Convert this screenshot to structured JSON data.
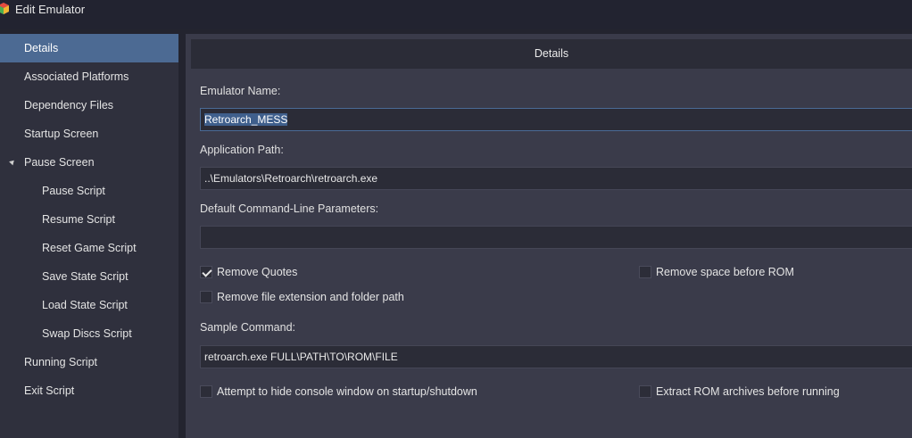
{
  "window": {
    "title": "Edit Emulator"
  },
  "sidebar": {
    "items": [
      {
        "label": "Details",
        "selected": true
      },
      {
        "label": "Associated Platforms"
      },
      {
        "label": "Dependency Files"
      },
      {
        "label": "Startup Screen"
      },
      {
        "label": "Pause Screen",
        "expanded": true
      },
      {
        "label": "Pause Script"
      },
      {
        "label": "Resume Script"
      },
      {
        "label": "Reset Game Script"
      },
      {
        "label": "Save State Script"
      },
      {
        "label": "Load State Script"
      },
      {
        "label": "Swap Discs Script"
      },
      {
        "label": "Running Script"
      },
      {
        "label": "Exit Script"
      }
    ]
  },
  "details": {
    "header": "Details",
    "emulator_name_label": "Emulator Name:",
    "emulator_name_value": "Retroarch_MESS",
    "application_path_label": "Application Path:",
    "application_path_value": "..\\Emulators\\Retroarch\\retroarch.exe",
    "default_params_label": "Default Command-Line Parameters:",
    "default_params_value": "",
    "remove_quotes_label": "Remove Quotes",
    "remove_quotes_checked": true,
    "remove_space_label": "Remove space before ROM",
    "remove_space_checked": false,
    "remove_ext_label": "Remove file extension and folder path",
    "remove_ext_checked": false,
    "sample_command_label": "Sample Command:",
    "sample_command_value": "retroarch.exe FULL\\PATH\\TO\\ROM\\FILE",
    "hide_console_label": "Attempt to hide console window on startup/shutdown",
    "hide_console_checked": false,
    "extract_rom_label": "Extract ROM archives before running",
    "extract_rom_checked": false
  },
  "colors": {
    "background": "#23242f",
    "sidebar": "#2f303d",
    "content": "#3a3b4a",
    "selection": "#4c6a93",
    "input": "#2b2c37"
  }
}
